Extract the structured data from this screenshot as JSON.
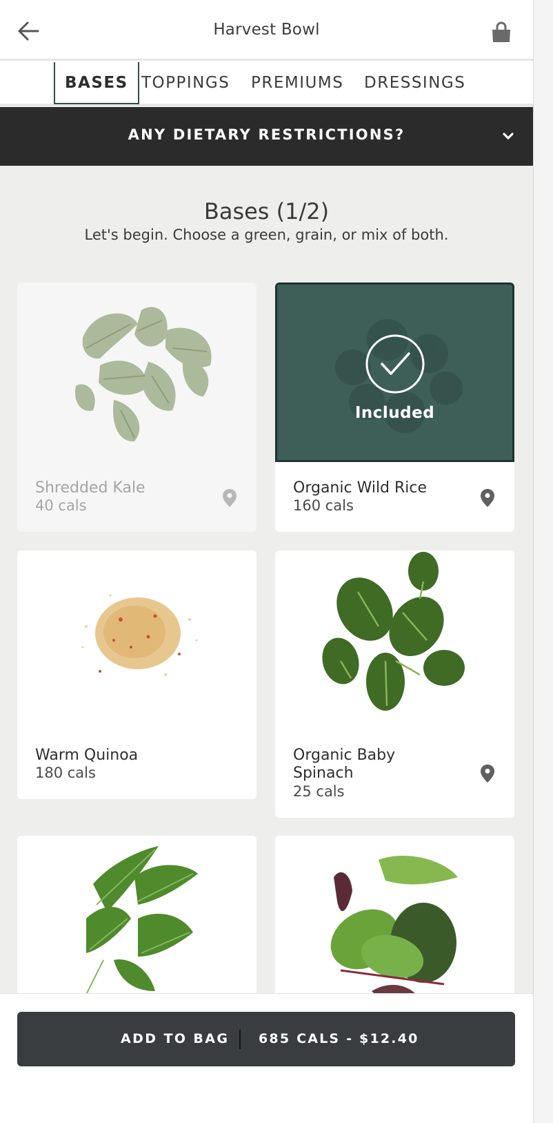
{
  "header": {
    "title": "Harvest Bowl",
    "back_icon": "arrow-left-icon",
    "bag_icon": "shopping-bag-icon"
  },
  "tabs": [
    {
      "label": "BASES",
      "active": true
    },
    {
      "label": "TOPPINGS",
      "active": false
    },
    {
      "label": "PREMIUMS",
      "active": false
    },
    {
      "label": "DRESSINGS",
      "active": false
    }
  ],
  "dietary": {
    "label": "ANY DIETARY RESTRICTIONS?",
    "icon": "chevron-down-icon"
  },
  "section": {
    "title": "Bases (1/2)",
    "subtitle": "Let's begin. Choose a green, grain, or mix of both."
  },
  "cards": [
    {
      "name": "Shredded Kale",
      "cals": "40 cals",
      "state": "unavailable",
      "has_pin": true
    },
    {
      "name": "Organic Wild Rice",
      "cals": "160 cals",
      "state": "selected",
      "has_pin": true,
      "badge": "Included"
    },
    {
      "name": "Warm Quinoa",
      "cals": "180 cals",
      "state": "default",
      "has_pin": false
    },
    {
      "name": "Organic Baby Spinach",
      "cals": "25 cals",
      "state": "default",
      "has_pin": true
    },
    {
      "name": "",
      "cals": "",
      "state": "default",
      "has_pin": false
    },
    {
      "name": "",
      "cals": "",
      "state": "default",
      "has_pin": false
    }
  ],
  "footer": {
    "add_label": "ADD TO BAG",
    "summary": "685 CALS - $12.40"
  },
  "colors": {
    "accent_green": "#3d5f58",
    "dark_bar": "#2b2b2b",
    "button_dark": "#3a3d40"
  }
}
